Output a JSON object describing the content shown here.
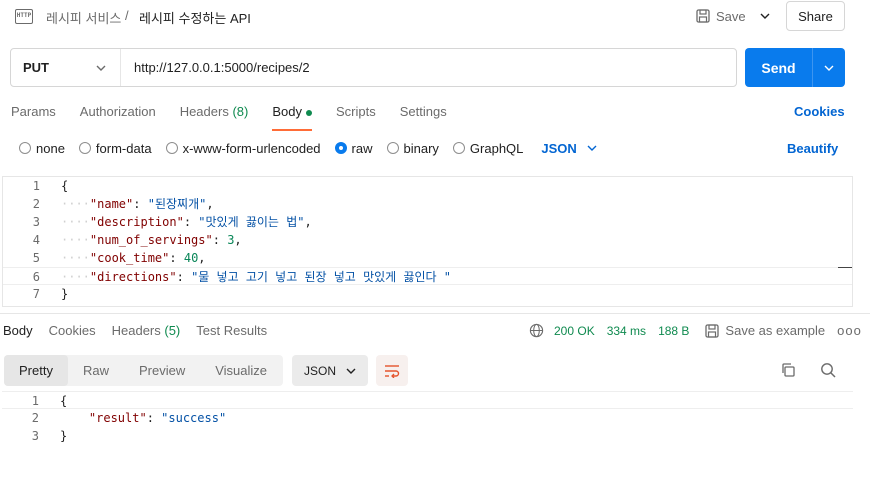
{
  "header": {
    "icon_text": "HTTP",
    "breadcrumb": "레시피 서비스",
    "separator": "/",
    "title": "레시피 수정하는 API",
    "save_label": "Save",
    "share_label": "Share"
  },
  "request": {
    "method": "PUT",
    "url": "http://127.0.0.1:5000/recipes/2",
    "send_label": "Send"
  },
  "request_tabs": [
    {
      "label": "Params"
    },
    {
      "label": "Authorization"
    },
    {
      "label": "Headers",
      "count": "(8)"
    },
    {
      "label": "Body"
    },
    {
      "label": "Scripts"
    },
    {
      "label": "Settings"
    }
  ],
  "cookies_label": "Cookies",
  "body_types": [
    "none",
    "form-data",
    "x-www-form-urlencoded",
    "raw",
    "binary",
    "GraphQL"
  ],
  "body_type_selected": "raw",
  "body_format": "JSON",
  "beautify_label": "Beautify",
  "request_body": {
    "line_numbers": [
      "1",
      "2",
      "3",
      "4",
      "5",
      "6",
      "7"
    ],
    "open_brace": "{",
    "close_brace": "}",
    "fields": [
      {
        "key": "\"name\"",
        "value": "\"된장찌개\"",
        "type": "string",
        "comma": ","
      },
      {
        "key": "\"description\"",
        "value": "\"맛있게 끓이는 법\"",
        "type": "string",
        "comma": ","
      },
      {
        "key": "\"num_of_servings\"",
        "value": "3",
        "type": "number",
        "comma": ","
      },
      {
        "key": "\"cook_time\"",
        "value": "40",
        "type": "number",
        "comma": ","
      },
      {
        "key": "\"directions\"",
        "value": "\"물 넣고 고기 넣고 된장 넣고 맛있게 끓인다 \"",
        "type": "string",
        "comma": ""
      }
    ]
  },
  "response_tabs": [
    {
      "label": "Body"
    },
    {
      "label": "Cookies"
    },
    {
      "label": "Headers",
      "count": "(5)"
    },
    {
      "label": "Test Results"
    }
  ],
  "response_status": {
    "code": "200 OK",
    "time": "334 ms",
    "size": "188 B",
    "save_example_label": "Save as example",
    "more_label": "ooo"
  },
  "response_view_tabs": [
    "Pretty",
    "Raw",
    "Preview",
    "Visualize"
  ],
  "response_format": "JSON",
  "response_body": {
    "line_numbers": [
      "1",
      "2",
      "3"
    ],
    "open_brace": "{",
    "close_brace": "}",
    "key": "\"result\"",
    "value": "\"success\""
  },
  "colors": {
    "accent": "#097bed",
    "link": "#0265d2",
    "success": "#0f8a4f",
    "tab_indicator": "#ff6c37",
    "json_key": "#800000",
    "json_string": "#0451a5",
    "json_number": "#098658"
  },
  "icons": [
    "http-icon",
    "save-icon",
    "chevron-down-icon",
    "globe-icon",
    "save-example-icon",
    "wrap-icon",
    "copy-icon",
    "search-icon"
  ]
}
